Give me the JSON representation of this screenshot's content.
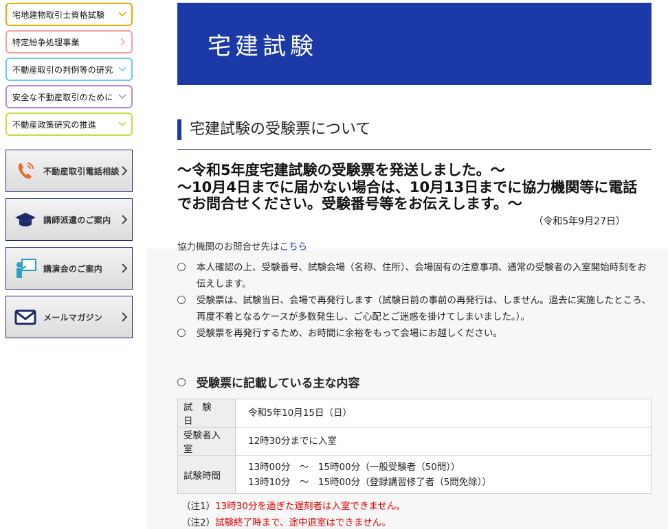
{
  "sidebar": {
    "nav": [
      {
        "label": "宅地建物取引士資格試験",
        "border": "#f0a500",
        "chev": "down"
      },
      {
        "label": "特定紛争処理事業",
        "border": "#f4a0a0",
        "chev": "right"
      },
      {
        "label": "不動産取引の判例等の研究",
        "border": "#66ccee",
        "chev": "down"
      },
      {
        "label": "安全な不動産取引のために",
        "border": "#b48ad8",
        "chev": "down"
      },
      {
        "label": "不動産政策研究の推進",
        "border": "#c8dc3c",
        "chev": "down"
      }
    ],
    "banners": [
      {
        "label": "不動産取引電話相談",
        "icon": "phone-icon"
      },
      {
        "label": "講師派遣のご案内",
        "icon": "graduation-cap-icon"
      },
      {
        "label": "講演会のご案内",
        "icon": "lecture-icon"
      },
      {
        "label": "メールマガジン",
        "icon": "mail-icon"
      }
    ]
  },
  "hero": {
    "title": "宅建試験"
  },
  "section": {
    "title": "宅建試験の受験票について"
  },
  "notice": {
    "line1": "〜令和5年度宅建試験の受験票を発送しました。〜",
    "line2": "〜10月4日までに届かない場合は、10月13日までに協力機関等に電話でお問合せください。受験番号等をお伝えします。〜",
    "date": "（令和5年9月27日）"
  },
  "contact": {
    "prefix": "協力機関のお問合せ先は",
    "link": "こちら"
  },
  "bullets": [
    "本人確認の上、受験番号、試験会場（名称、住所）、会場固有の注意事項、通常の受験者の入室開始時刻をお伝えします。",
    "受験票は、試験当日、会場で再発行します（試験日前の事前の再発行は、しません。過去に実施したところ、再度不着となるケースが多数発生し、ご心配とご迷惑を掛けてしまいました。）。",
    "受験票を再発行するため、お時間に余裕をもって会場にお越しください。"
  ],
  "contents": {
    "heading": "受験票に記載している主な内容",
    "rows": [
      {
        "label": "試　験　日",
        "value": "令和5年10月15日（日）"
      },
      {
        "label": "受験者入室",
        "value": "12時30分までに入室"
      },
      {
        "label": "試験時間",
        "value1": "13時00分　〜　15時00分（一般受験者（50問））",
        "value2": "13時10分　〜　15時00分（登録講習修了者（5問免除））"
      }
    ]
  },
  "notes": [
    {
      "prefix": "（注1）",
      "text": "13時30分を過ぎた遅刻者は入室できません。"
    },
    {
      "prefix": "（注2）",
      "text": "試験終了時まで、途中退室はできません。"
    }
  ],
  "colors": {
    "brand": "#1b3aa8",
    "alert": "#e00000"
  }
}
